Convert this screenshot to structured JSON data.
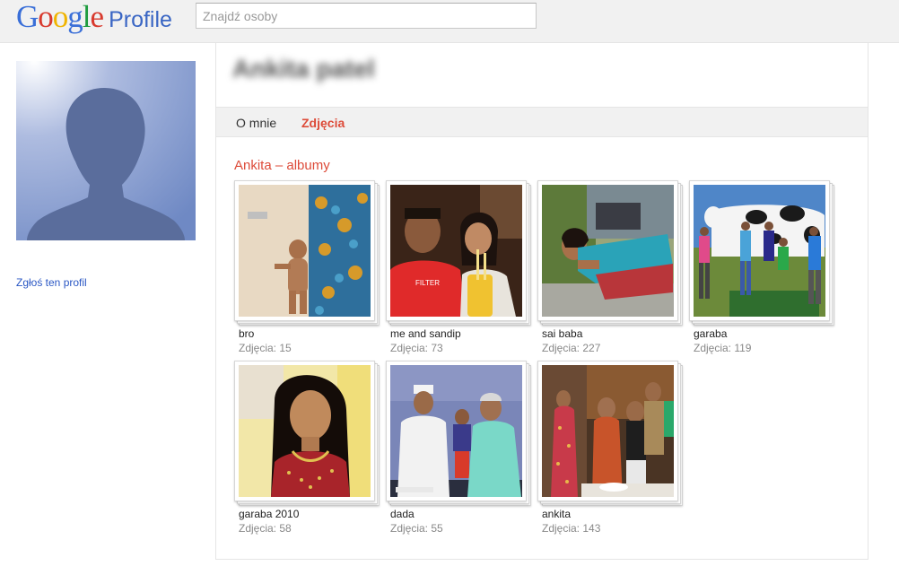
{
  "header": {
    "logo_text": "Google",
    "product_name": "Profile",
    "search_placeholder": "Znajdź osoby"
  },
  "sidebar": {
    "report_link": "Zgłoś ten profil"
  },
  "profile": {
    "name": "Ankita patel"
  },
  "tabs": [
    {
      "label": "O mnie",
      "active": false
    },
    {
      "label": "Zdjęcia",
      "active": true
    }
  ],
  "albums": {
    "heading": "Ankita – albumy",
    "items": [
      {
        "title": "bro",
        "count": "Zdjęcia: 15"
      },
      {
        "title": "me and sandip",
        "count": "Zdjęcia: 73"
      },
      {
        "title": "sai baba",
        "count": "Zdjęcia: 227"
      },
      {
        "title": "garaba",
        "count": "Zdjęcia: 119"
      },
      {
        "title": "garaba 2010",
        "count": "Zdjęcia: 58"
      },
      {
        "title": "dada",
        "count": "Zdjęcia: 55"
      },
      {
        "title": "ankita",
        "count": "Zdjęcia: 143"
      }
    ]
  },
  "colors": {
    "accent": "#dd4b39",
    "link": "#2a57c4",
    "header_bg": "#f1f1f1",
    "avatar_bg": "#6b84bf"
  }
}
